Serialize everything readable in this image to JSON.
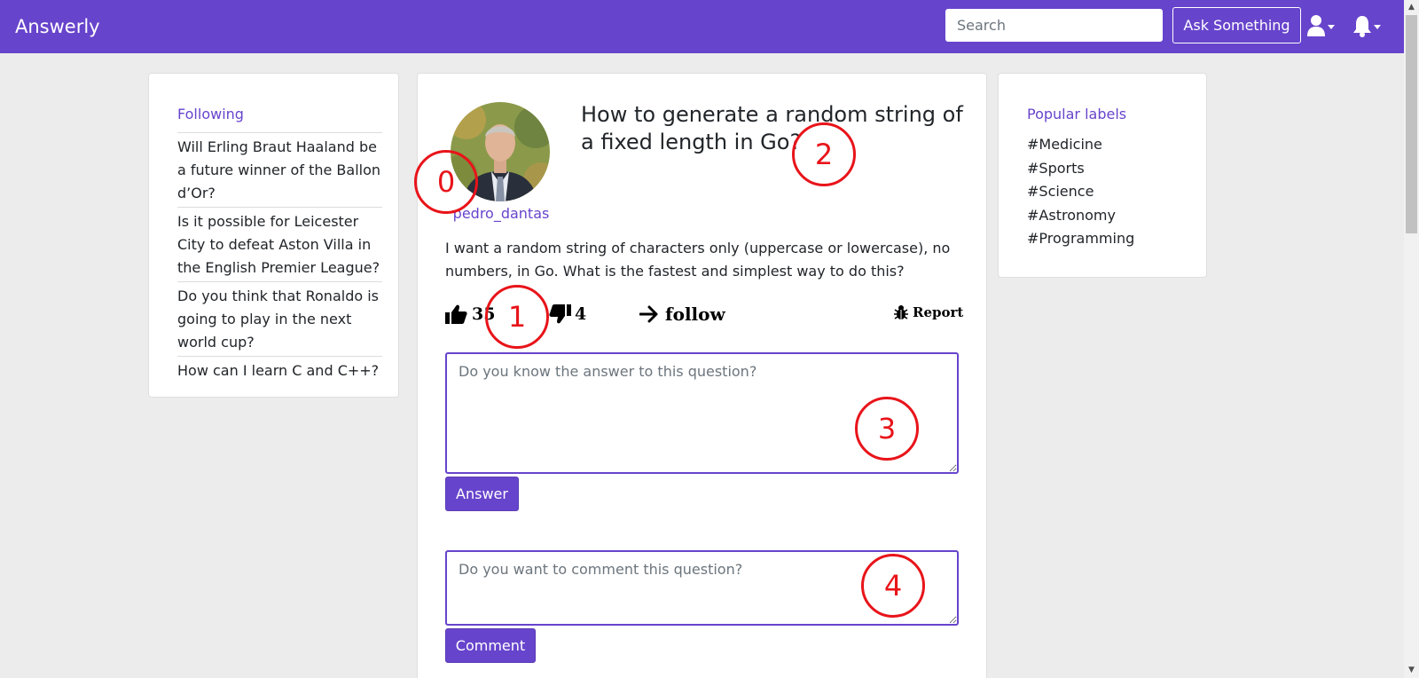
{
  "navbar": {
    "brand": "Answerly",
    "search_placeholder": "Search",
    "ask_label": "Ask Something",
    "background_color": "#6744cc"
  },
  "sidebar_left": {
    "heading": "Following",
    "items": [
      "Will Erling Braut Haaland be a future winner of the Ballon d’Or?",
      "Is it possible for Leicester City to defeat Aston Villa in the English Premier League?",
      "Do you think that Ronaldo is going to play in the next world cup?",
      "How can I learn C and C++?"
    ]
  },
  "question": {
    "username": "pedro_dantas",
    "title": "How to generate a random string of a fixed length in Go?",
    "body": "I want a random string of characters only (uppercase or lowercase), no numbers, in Go. What is the fastest and simplest way to do this?",
    "upvotes": "35",
    "downvotes": "4",
    "follow_label": "follow",
    "report_label": "Report"
  },
  "answer_form": {
    "placeholder": "Do you know the answer to this question?",
    "button_label": "Answer"
  },
  "comment_form": {
    "placeholder": "Do you want to comment this question?",
    "button_label": "Comment"
  },
  "sidebar_right": {
    "heading": "Popular labels",
    "labels": [
      "#Medicine",
      "#Sports",
      "#Science",
      "#Astronomy",
      "#Programming"
    ]
  },
  "annotations": [
    "0",
    "1",
    "2",
    "3",
    "4"
  ],
  "icons": {
    "user": "user-icon",
    "bell": "bell-icon",
    "thumbs_up": "thumbs-up-icon",
    "thumbs_down": "thumbs-down-icon",
    "arrow": "arrow-right-icon",
    "bug": "bug-icon"
  }
}
